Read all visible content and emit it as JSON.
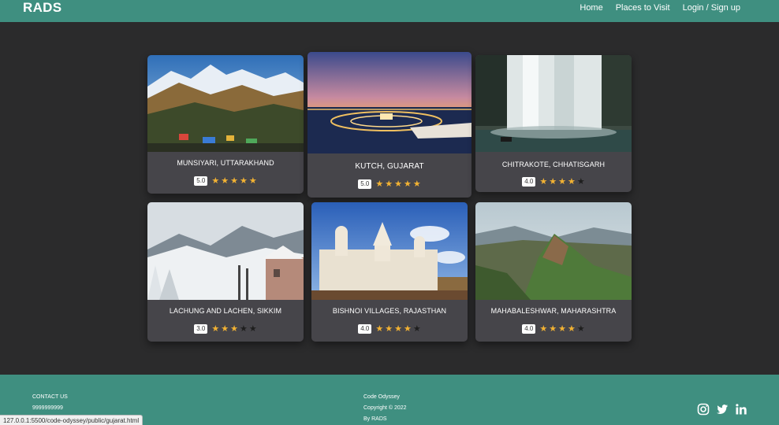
{
  "nav": {
    "brand": "RADS",
    "links": [
      "Home",
      "Places to Visit",
      "Login / Sign up"
    ]
  },
  "cards": [
    {
      "title": "MUNSIYARI, UTTARAKHAND",
      "rating": "5.0",
      "stars": 5
    },
    {
      "title": "KUTCH, GUJARAT",
      "rating": "5.0",
      "stars": 5
    },
    {
      "title": "CHITRAKOTE, CHHATISGARH",
      "rating": "4.0",
      "stars": 4
    },
    {
      "title": "LACHUNG AND LACHEN, SIKKIM",
      "rating": "3.0",
      "stars": 3
    },
    {
      "title": "BISHNOI VILLAGES, RAJASTHAN",
      "rating": "4.0",
      "stars": 4
    },
    {
      "title": "MAHABALESHWAR, MAHARASHTRA",
      "rating": "4.0",
      "stars": 4
    }
  ],
  "footer": {
    "contact_heading": "CONTACT US",
    "phone": "9999999999",
    "org": "Code Odyssey",
    "copyright": "Copyright © 2022",
    "by": "By RADS",
    "social": [
      "instagram-icon",
      "twitter-icon",
      "linkedin-icon"
    ]
  },
  "status_url": "127.0.0.1:5500/code-odyssey/public/gujarat.html",
  "colors": {
    "accent": "#3f8f80",
    "background": "#2b2b2c",
    "card": "#46454a",
    "star": "#f2b233"
  }
}
